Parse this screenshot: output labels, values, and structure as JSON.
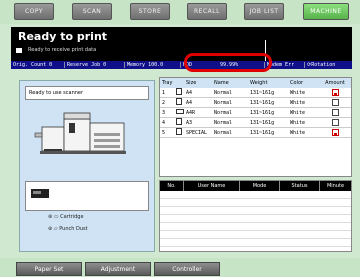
{
  "tabs": [
    {
      "label": "COPY"
    },
    {
      "label": "SCAN"
    },
    {
      "label": "STORE"
    },
    {
      "label": "RECALL"
    },
    {
      "label": "JOB LIST"
    },
    {
      "label": "MACHINE"
    }
  ],
  "status": {
    "title": "Ready to print",
    "subtitle": "Ready to receive print data"
  },
  "counters": {
    "orig_count_label": "Orig. Count",
    "orig_count": "0",
    "reserve_job_label": "Reserve Job",
    "reserve_job": "0",
    "memory_label": "Memory",
    "memory": "100.0",
    "hdd_label": "HDD",
    "hdd": "99.99%",
    "modem_err": "Modem Err",
    "rotation": "Rotation"
  },
  "scanner": {
    "status": "Ready to use scanner"
  },
  "consumables": [
    {
      "label": "Cartridge"
    },
    {
      "label": "Punch Dust"
    }
  ],
  "tray_table": {
    "headers": [
      "Tray",
      "Size",
      "Name",
      "Weight",
      "Color",
      "Amount"
    ],
    "rows": [
      {
        "tray": "1",
        "size": "A4",
        "name": "Normal",
        "weight": "131~161g",
        "color": "White",
        "low": true
      },
      {
        "tray": "2",
        "size": "A4",
        "name": "Normal",
        "weight": "131~161g",
        "color": "White",
        "low": false
      },
      {
        "tray": "3",
        "size": "A4R",
        "name": "Normal",
        "weight": "131~161g",
        "color": "White",
        "low": false
      },
      {
        "tray": "4",
        "size": "A3",
        "name": "Normal",
        "weight": "131~161g",
        "color": "White",
        "low": false
      },
      {
        "tray": "5",
        "size": "SPECIAL",
        "name": "Normal",
        "weight": "131~161g",
        "color": "White",
        "low": true
      }
    ]
  },
  "job_table": {
    "headers": [
      "No.",
      "User Name",
      "Mode",
      "Status",
      "Minute"
    ]
  },
  "bottom_buttons": [
    {
      "label": "Paper Set"
    },
    {
      "label": "Adjustment"
    },
    {
      "label": "Controller"
    }
  ]
}
